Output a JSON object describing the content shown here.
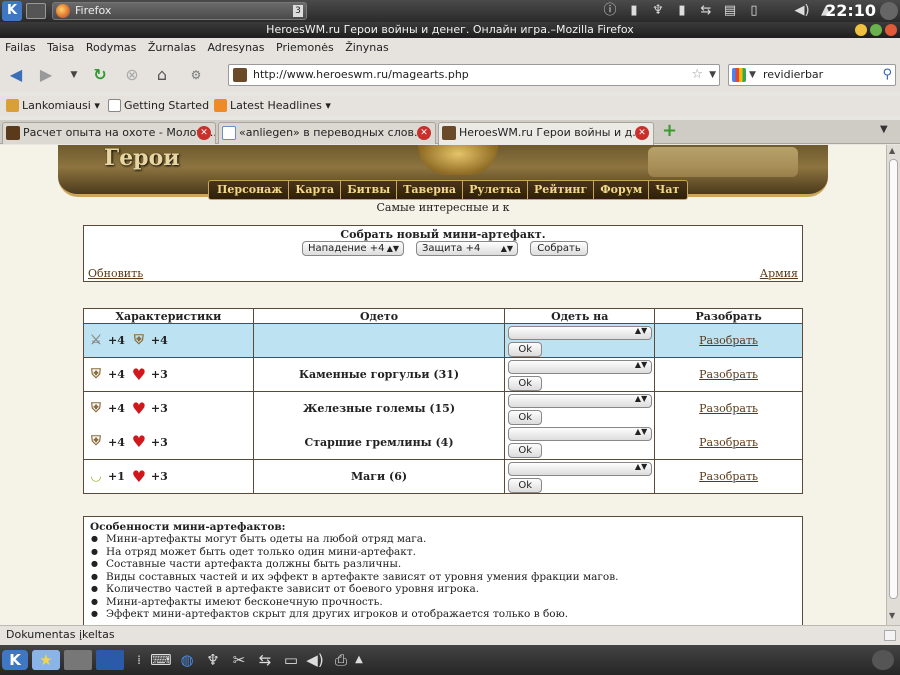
{
  "top_panel": {
    "task_title": "Firefox",
    "task_count": "3",
    "clock": "22:10"
  },
  "window": {
    "title": "HeroesWM.ru Герои войны и денег. Онлайн игра.–Mozilla Firefox"
  },
  "menu": [
    "Failas",
    "Taisa",
    "Rodymas",
    "Žurnalas",
    "Adresynas",
    "Priemonės",
    "Žinynas"
  ],
  "nav": {
    "url": "http://www.heroeswm.ru/magearts.php",
    "search_value": "revidierbar"
  },
  "bookmarks": [
    "Lankomiausi",
    "Getting Started",
    "Latest Headlines"
  ],
  "tabs": [
    {
      "label": "Расчет опыта на охоте - Молот ..."
    },
    {
      "label": "«anliegen» в переводных слов..."
    },
    {
      "label": "HeroesWM.ru Герои войны и д..."
    }
  ],
  "game": {
    "logo": "Герои",
    "nav": [
      "Персонаж",
      "Карта",
      "Битвы",
      "Таверна",
      "Рулетка",
      "Рейтинг",
      "Форум",
      "Чат"
    ],
    "tagline": "Самые интересные и к"
  },
  "collect": {
    "title": "Собрать новый мини-артефакт.",
    "attack_select": "Нападение +4",
    "defense_select": "Защита +4",
    "collect_button": "Собрать",
    "refresh_link": "Обновить",
    "army_link": "Армия"
  },
  "table": {
    "headers": [
      "Характеристики",
      "Одето",
      "Одеть на",
      "Разобрать"
    ],
    "ok_label": "Ok",
    "disassemble_label": "Разобрать",
    "rows": [
      {
        "icon1": "sword-icon",
        "v1": "+4",
        "icon2": "shield-icon",
        "v2": "+4",
        "worn": ""
      },
      {
        "icon1": "shield-icon",
        "v1": "+4",
        "icon2": "heart-icon",
        "v2": "+3",
        "worn": "Каменные горгульи (31)"
      },
      {
        "icon1": "shield-icon",
        "v1": "+4",
        "icon2": "heart-icon",
        "v2": "+3",
        "worn": "Железные големы (15)"
      },
      {
        "icon1": "shield-icon",
        "v1": "+4",
        "icon2": "heart-icon",
        "v2": "+3",
        "worn": "Старшие гремлины (4)"
      },
      {
        "icon1": "bow-icon",
        "v1": "+1",
        "icon2": "heart-icon",
        "v2": "+3",
        "worn": "Маги (6)"
      }
    ]
  },
  "info": {
    "title": "Особенности мини-артефактов:",
    "items": [
      "Мини-артефакты могут быть одеты на любой отряд мага.",
      "На отряд может быть одет только один мини-артефакт.",
      "Составные части артефакта должны быть различны.",
      "Виды составных частей и их эффект в артефакте зависят от уровня умения фракции магов.",
      "Количество частей в артефакте зависит от боевого уровня игрока.",
      "Мини-артефакты имеют бесконечную прочность.",
      "Эффект мини-артефактов скрыт для других игроков и отображается только в бою."
    ]
  },
  "status": "Dokumentas įkeltas"
}
